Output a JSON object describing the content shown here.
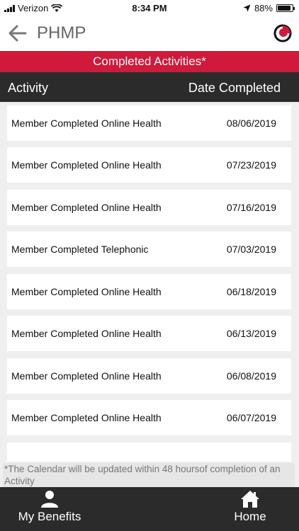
{
  "status_bar": {
    "carrier": "Verizon",
    "time": "8:34 PM",
    "battery": "88%",
    "battery_level": 0.88
  },
  "nav": {
    "title": "PHMP",
    "back_icon": "arrow-left-icon",
    "logo_icon": "brand-logo-icon"
  },
  "banner": {
    "title": "Completed Activities*"
  },
  "columns": {
    "activity": "Activity",
    "date": "Date Completed"
  },
  "rows": [
    {
      "activity": "Member Completed Online Health",
      "date": "08/06/2019"
    },
    {
      "activity": "Member Completed Online Health",
      "date": "07/23/2019"
    },
    {
      "activity": "Member Completed Online Health",
      "date": "07/16/2019"
    },
    {
      "activity": "Member Completed Telephonic",
      "date": "07/03/2019"
    },
    {
      "activity": "Member Completed Online Health",
      "date": "06/18/2019"
    },
    {
      "activity": "Member Completed Online Health",
      "date": "06/13/2019"
    },
    {
      "activity": "Member Completed Online Health",
      "date": "06/08/2019"
    },
    {
      "activity": "Member Completed Online Health",
      "date": "06/07/2019"
    },
    {
      "activity": "",
      "date": ""
    }
  ],
  "footnote": "*The Calendar will be updated within 48 hoursof completion of an Activity",
  "tabs": {
    "benefits": "My Benefits",
    "home": "Home"
  },
  "colors": {
    "accent": "#d0193b",
    "dark": "#2b2b2b"
  }
}
